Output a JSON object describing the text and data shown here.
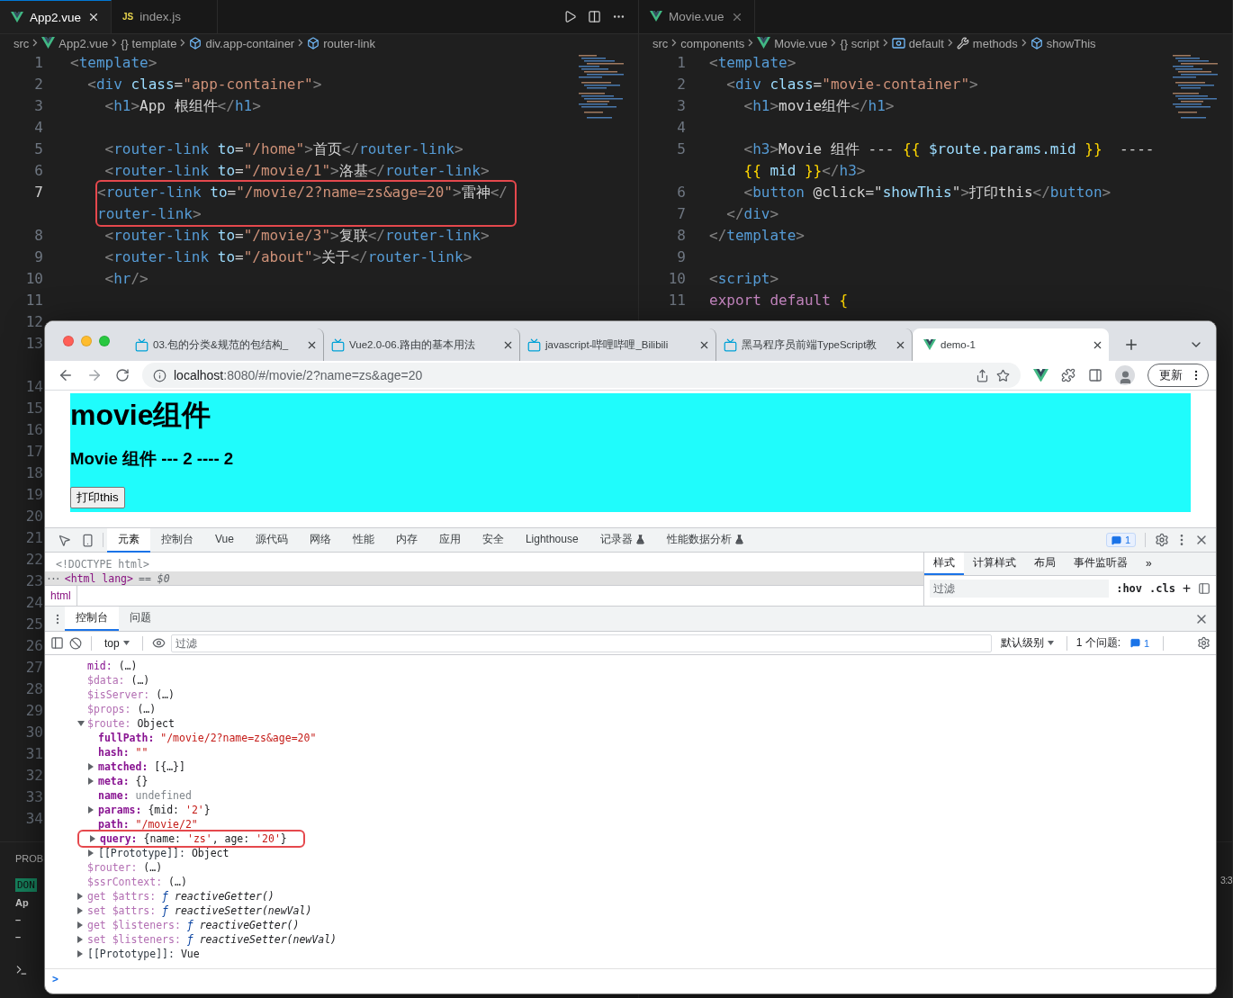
{
  "editor_left": {
    "tabs": [
      {
        "label": "App2.vue",
        "kind": "vue",
        "selected": true
      },
      {
        "label": "index.js",
        "kind": "js",
        "icon_text": "JS",
        "selected": false
      }
    ],
    "breadcrumbs": [
      {
        "kind": "plain",
        "text": "src"
      },
      {
        "kind": "vue",
        "text": "App2.vue"
      },
      {
        "kind": "plain",
        "text": "{} template"
      },
      {
        "kind": "cube",
        "text": "div.app-container"
      },
      {
        "kind": "cube",
        "text": "router-link"
      }
    ],
    "lines": [
      {
        "number": "1",
        "tokens": [
          {
            "kind": "punct",
            "text": "<"
          },
          {
            "kind": "tag",
            "text": "template"
          },
          {
            "kind": "punct",
            "text": ">"
          }
        ]
      },
      {
        "number": "2",
        "tokens": [
          {
            "kind": "punct",
            "text": "  <"
          },
          {
            "kind": "tag",
            "text": "div"
          },
          {
            "kind": "attr",
            "text": " class"
          },
          {
            "kind": "text",
            "text": "="
          },
          {
            "kind": "string",
            "text": "\"app-container\""
          },
          {
            "kind": "punct",
            "text": ">"
          }
        ]
      },
      {
        "number": "3",
        "tokens": [
          {
            "kind": "punct",
            "text": "    <"
          },
          {
            "kind": "tag",
            "text": "h1"
          },
          {
            "kind": "punct",
            "text": ">"
          },
          {
            "kind": "text",
            "text": "App 根组件"
          },
          {
            "kind": "punct",
            "text": "</"
          },
          {
            "kind": "tag",
            "text": "h1"
          },
          {
            "kind": "punct",
            "text": ">"
          }
        ]
      },
      {
        "number": "4"
      },
      {
        "number": "5",
        "tokens": [
          {
            "kind": "punct",
            "text": "    <"
          },
          {
            "kind": "tag",
            "text": "router-link"
          },
          {
            "kind": "attr",
            "text": " to"
          },
          {
            "kind": "text",
            "text": "="
          },
          {
            "kind": "string",
            "text": "\"/home\""
          },
          {
            "kind": "punct",
            "text": ">"
          },
          {
            "kind": "text",
            "text": "首页"
          },
          {
            "kind": "punct",
            "text": "</"
          },
          {
            "kind": "tag",
            "text": "router-link"
          },
          {
            "kind": "punct",
            "text": ">"
          }
        ]
      },
      {
        "number": "6",
        "tokens": [
          {
            "kind": "punct",
            "text": "    <"
          },
          {
            "kind": "tag",
            "text": "router-link"
          },
          {
            "kind": "attr",
            "text": " to"
          },
          {
            "kind": "text",
            "text": "="
          },
          {
            "kind": "string",
            "text": "\"/movie/1\""
          },
          {
            "kind": "punct",
            "text": ">"
          },
          {
            "kind": "text",
            "text": "洛基"
          },
          {
            "kind": "punct",
            "text": "</"
          },
          {
            "kind": "tag",
            "text": "router-link"
          },
          {
            "kind": "punct",
            "text": ">"
          }
        ]
      },
      {
        "number": "7",
        "highlighted": true,
        "tokens": [
          {
            "kind": "punct",
            "text": "<"
          },
          {
            "kind": "tag",
            "text": "router-link"
          },
          {
            "kind": "attr",
            "text": " to"
          },
          {
            "kind": "text",
            "text": "="
          },
          {
            "kind": "string",
            "text": "\"/movie/2?name=zs&age=20\""
          },
          {
            "kind": "punct",
            "text": ">"
          },
          {
            "kind": "text",
            "text": "雷神"
          },
          {
            "kind": "punct",
            "text": "</"
          }
        ],
        "continuation": [
          {
            "kind": "tag",
            "text": "router-link"
          },
          {
            "kind": "punct",
            "text": ">"
          }
        ]
      },
      {
        "number": "8",
        "tokens": [
          {
            "kind": "punct",
            "text": "    <"
          },
          {
            "kind": "tag",
            "text": "router-link"
          },
          {
            "kind": "attr",
            "text": " to"
          },
          {
            "kind": "text",
            "text": "="
          },
          {
            "kind": "string",
            "text": "\"/movie/3\""
          },
          {
            "kind": "punct",
            "text": ">"
          },
          {
            "kind": "text",
            "text": "复联"
          },
          {
            "kind": "punct",
            "text": "</"
          },
          {
            "kind": "tag",
            "text": "router-link"
          },
          {
            "kind": "punct",
            "text": ">"
          }
        ]
      },
      {
        "number": "9",
        "tokens": [
          {
            "kind": "punct",
            "text": "    <"
          },
          {
            "kind": "tag",
            "text": "router-link"
          },
          {
            "kind": "attr",
            "text": " to"
          },
          {
            "kind": "text",
            "text": "="
          },
          {
            "kind": "string",
            "text": "\"/about\""
          },
          {
            "kind": "punct",
            "text": ">"
          },
          {
            "kind": "text",
            "text": "关于"
          },
          {
            "kind": "punct",
            "text": "</"
          },
          {
            "kind": "tag",
            "text": "router-link"
          },
          {
            "kind": "punct",
            "text": ">"
          }
        ]
      },
      {
        "number": "10",
        "tokens": [
          {
            "kind": "punct",
            "text": "    <"
          },
          {
            "kind": "tag",
            "text": "hr"
          },
          {
            "kind": "punct",
            "text": "/>"
          }
        ]
      },
      {
        "number": "11"
      },
      {
        "number": "12"
      },
      {
        "number": "13",
        "wrapped": true
      },
      {
        "number": "14"
      },
      {
        "number": "15"
      },
      {
        "number": "16"
      },
      {
        "number": "17"
      },
      {
        "number": "18"
      },
      {
        "number": "19"
      },
      {
        "number": "20"
      },
      {
        "number": "21"
      },
      {
        "number": "22"
      },
      {
        "number": "23"
      },
      {
        "number": "24"
      },
      {
        "number": "25"
      },
      {
        "number": "26"
      },
      {
        "number": "27"
      },
      {
        "number": "28"
      },
      {
        "number": "29"
      },
      {
        "number": "30"
      },
      {
        "number": "31"
      },
      {
        "number": "32"
      },
      {
        "number": "33"
      },
      {
        "number": "34"
      }
    ],
    "panel": [
      {
        "kind": "label",
        "text": "PROB"
      },
      {
        "kind": "badge",
        "text": "DON"
      },
      {
        "kind": "text",
        "text": "Ap"
      },
      {
        "kind": "text",
        "text": "–"
      },
      {
        "kind": "text",
        "text": "–"
      }
    ]
  },
  "editor_right": {
    "tabs": [
      {
        "label": "Movie.vue",
        "kind": "vue",
        "selected": false
      }
    ],
    "breadcrumbs": [
      {
        "kind": "plain",
        "text": "src"
      },
      {
        "kind": "plain",
        "text": "components"
      },
      {
        "kind": "vue",
        "text": "Movie.vue"
      },
      {
        "kind": "plain",
        "text": "{} script"
      },
      {
        "kind": "field",
        "text": "default"
      },
      {
        "kind": "wrench",
        "text": "methods"
      },
      {
        "kind": "cube",
        "text": "showThis"
      }
    ],
    "lines": [
      {
        "number": "1",
        "tokens": [
          {
            "kind": "punct",
            "text": "<"
          },
          {
            "kind": "tag",
            "text": "template"
          },
          {
            "kind": "punct",
            "text": ">"
          }
        ]
      },
      {
        "number": "2",
        "tokens": [
          {
            "kind": "punct",
            "text": "  <"
          },
          {
            "kind": "tag",
            "text": "div"
          },
          {
            "kind": "attr",
            "text": " class"
          },
          {
            "kind": "text",
            "text": "="
          },
          {
            "kind": "string",
            "text": "\"movie-container\""
          },
          {
            "kind": "punct",
            "text": ">"
          }
        ]
      },
      {
        "number": "3",
        "tokens": [
          {
            "kind": "punct",
            "text": "    <"
          },
          {
            "kind": "tag",
            "text": "h1"
          },
          {
            "kind": "punct",
            "text": ">"
          },
          {
            "kind": "text",
            "text": "movie组件"
          },
          {
            "kind": "punct",
            "text": "</"
          },
          {
            "kind": "tag",
            "text": "h1"
          },
          {
            "kind": "punct",
            "text": ">"
          }
        ]
      },
      {
        "number": "4"
      },
      {
        "number": "5",
        "tokens": [
          {
            "kind": "punct",
            "text": "    <"
          },
          {
            "kind": "tag",
            "text": "h3"
          },
          {
            "kind": "punct",
            "text": ">"
          },
          {
            "kind": "text",
            "text": "Movie 组件 --- "
          },
          {
            "kind": "brace",
            "text": "{{"
          },
          {
            "kind": "attr",
            "text": " $route.params.mid "
          },
          {
            "kind": "brace",
            "text": "}}"
          },
          {
            "kind": "text",
            "text": "  ----"
          }
        ],
        "continuation": [
          {
            "kind": "brace",
            "text": "    {{"
          },
          {
            "kind": "attr",
            "text": " mid "
          },
          {
            "kind": "brace",
            "text": "}}"
          },
          {
            "kind": "punct",
            "text": "</"
          },
          {
            "kind": "tag",
            "text": "h3"
          },
          {
            "kind": "punct",
            "text": ">"
          }
        ]
      },
      {
        "number": "6",
        "tokens": [
          {
            "kind": "punct",
            "text": "    <"
          },
          {
            "kind": "tag",
            "text": "button"
          },
          {
            "kind": "text",
            "text": " @click=\""
          },
          {
            "kind": "attr",
            "text": "showThis"
          },
          {
            "kind": "text",
            "text": "\""
          },
          {
            "kind": "punct",
            "text": ">"
          },
          {
            "kind": "text",
            "text": "打印this"
          },
          {
            "kind": "punct",
            "text": "</"
          },
          {
            "kind": "tag",
            "text": "button"
          },
          {
            "kind": "punct",
            "text": ">"
          }
        ]
      },
      {
        "number": "7",
        "tokens": [
          {
            "kind": "punct",
            "text": "  </"
          },
          {
            "kind": "tag",
            "text": "div"
          },
          {
            "kind": "punct",
            "text": ">"
          }
        ]
      },
      {
        "number": "8",
        "tokens": [
          {
            "kind": "punct",
            "text": "</"
          },
          {
            "kind": "tag",
            "text": "template"
          },
          {
            "kind": "punct",
            "text": ">"
          }
        ]
      },
      {
        "number": "9"
      },
      {
        "number": "10",
        "tokens": [
          {
            "kind": "punct",
            "text": "<"
          },
          {
            "kind": "tag",
            "text": "script"
          },
          {
            "kind": "punct",
            "text": ">"
          }
        ]
      },
      {
        "number": "11",
        "tokens": [
          {
            "kind": "keyword",
            "text": "export default "
          },
          {
            "kind": "brace",
            "text": "{"
          }
        ]
      }
    ],
    "panel": [
      {
        "kind": "status",
        "text": "3:3"
      }
    ]
  },
  "browser": {
    "tabs": [
      {
        "title": "03.包的分类&规范的包结构_",
        "kind": "tv",
        "selected": false
      },
      {
        "title": "Vue2.0-06.路由的基本用法",
        "kind": "tv",
        "selected": false
      },
      {
        "title": "javascript-哔哩哔哩_Bilibili",
        "kind": "tv",
        "selected": false
      },
      {
        "title": "黑马程序员前端TypeScript教",
        "kind": "tv",
        "selected": false
      },
      {
        "title": "demo-1",
        "kind": "vue",
        "selected": true
      }
    ],
    "url": {
      "host": "localhost",
      "path": ":8080/#/movie/2?name=zs&age=20"
    },
    "update_button": "更新",
    "page": {
      "heading": "movie组件",
      "subheading": "Movie 组件 --- 2 ---- 2",
      "button": "打印this"
    },
    "devtools": {
      "tabs": [
        {
          "label": "元素",
          "selected": true
        },
        {
          "label": "控制台",
          "selected": false
        },
        {
          "label": "Vue",
          "selected": false
        },
        {
          "label": "源代码",
          "selected": false
        },
        {
          "label": "网络",
          "selected": false
        },
        {
          "label": "性能",
          "selected": false
        },
        {
          "label": "内存",
          "selected": false
        },
        {
          "label": "应用",
          "selected": false
        },
        {
          "label": "安全",
          "selected": false
        },
        {
          "label": "Lighthouse",
          "selected": false
        },
        {
          "label": "记录器",
          "selected": false,
          "experimental": true
        },
        {
          "label": "性能数据分析",
          "selected": false,
          "experimental": true
        }
      ],
      "issues_badge": "1",
      "elements": {
        "rows": [
          {
            "kind": "doctype",
            "text": "<!DOCTYPE html>",
            "selected": false
          },
          {
            "kind": "element",
            "prefix": "···",
            "text": "<html lang>",
            "suffix": "== $0",
            "selected": true
          }
        ],
        "breadcrumb": "html"
      },
      "styles": {
        "tabs": [
          {
            "label": "样式",
            "selected": true
          },
          {
            "label": "计算样式",
            "selected": false
          },
          {
            "label": "布局",
            "selected": false
          },
          {
            "label": "事件监听器",
            "selected": false
          }
        ],
        "more": "»",
        "filter_placeholder": "过滤",
        "hov": ":hov",
        "cls": ".cls",
        "add": "+"
      },
      "drawer": {
        "tabs": [
          {
            "label": "控制台",
            "selected": true
          },
          {
            "label": "问题",
            "selected": false
          }
        ]
      },
      "console": {
        "context": "top",
        "filter_placeholder": "过滤",
        "level": "默认级别",
        "issues_label": "1 个问题:",
        "issues_count": "1",
        "entries": [
          {
            "key": "mid:",
            "kind": "own",
            "parts": [
              {
                "kind": "plain",
                "text": "(…)"
              }
            ]
          },
          {
            "key": "$data:",
            "kind": "inherited",
            "parts": [
              {
                "kind": "plain",
                "text": "(…)"
              }
            ]
          },
          {
            "key": "$isServer:",
            "kind": "inherited",
            "parts": [
              {
                "kind": "plain",
                "text": "(…)"
              }
            ]
          },
          {
            "key": "$props:",
            "kind": "inherited",
            "parts": [
              {
                "kind": "plain",
                "text": "(…)"
              }
            ]
          },
          {
            "expanded": true,
            "key": "$route:",
            "kind": "inherited",
            "parts": [
              {
                "kind": "plain",
                "text": "Object"
              }
            ],
            "children": [
              {
                "key": "fullPath:",
                "kind": "bold",
                "parts": [
                  {
                    "kind": "string",
                    "text": "\"/movie/2?name=zs&age=20\""
                  }
                ]
              },
              {
                "key": "hash:",
                "kind": "bold",
                "parts": [
                  {
                    "kind": "string",
                    "text": "\"\""
                  }
                ]
              },
              {
                "expanded": false,
                "key": "matched:",
                "kind": "bold",
                "parts": [
                  {
                    "kind": "plain",
                    "text": "[{…}]"
                  }
                ]
              },
              {
                "expanded": false,
                "key": "meta:",
                "kind": "bold",
                "parts": [
                  {
                    "kind": "plain",
                    "text": "{}"
                  }
                ]
              },
              {
                "key": "name:",
                "kind": "bold",
                "parts": [
                  {
                    "kind": "muted",
                    "text": "undefined"
                  }
                ]
              },
              {
                "expanded": false,
                "key": "params:",
                "kind": "bold",
                "parts": [
                  {
                    "kind": "plain",
                    "text": "{mid: "
                  },
                  {
                    "kind": "string",
                    "text": "'2'"
                  },
                  {
                    "kind": "plain",
                    "text": "}"
                  }
                ]
              },
              {
                "key": "path:",
                "kind": "bold",
                "parts": [
                  {
                    "kind": "string",
                    "text": "\"/movie/2\""
                  }
                ]
              },
              {
                "expanded": false,
                "key": "query:",
                "kind": "bold",
                "highlighted": true,
                "parts": [
                  {
                    "kind": "plain",
                    "text": "{name: "
                  },
                  {
                    "kind": "string",
                    "text": "'zs'"
                  },
                  {
                    "kind": "plain",
                    "text": ", age: "
                  },
                  {
                    "kind": "string",
                    "text": "'20'"
                  },
                  {
                    "kind": "plain",
                    "text": "}"
                  }
                ]
              },
              {
                "expanded": false,
                "key": "[[Prototype]]:",
                "kind": "internal",
                "parts": [
                  {
                    "kind": "plain",
                    "text": "Object"
                  }
                ]
              }
            ]
          },
          {
            "key": "$router:",
            "kind": "inherited",
            "parts": [
              {
                "kind": "plain",
                "text": "(…)"
              }
            ]
          },
          {
            "key": "$ssrContext:",
            "kind": "inherited",
            "parts": [
              {
                "kind": "plain",
                "text": "(…)"
              }
            ]
          },
          {
            "expanded": false,
            "key": "get $attrs:",
            "kind": "inherited",
            "parts": [
              {
                "kind": "func",
                "text": "ƒ"
              },
              {
                "kind": "italic",
                "text": "reactiveGetter()"
              }
            ]
          },
          {
            "expanded": false,
            "key": "set $attrs:",
            "kind": "inherited",
            "parts": [
              {
                "kind": "func",
                "text": "ƒ"
              },
              {
                "kind": "italic",
                "text": "reactiveSetter(newVal)"
              }
            ]
          },
          {
            "expanded": false,
            "key": "get $listeners:",
            "kind": "inherited",
            "parts": [
              {
                "kind": "func",
                "text": "ƒ"
              },
              {
                "kind": "italic",
                "text": "reactiveGetter()"
              }
            ]
          },
          {
            "expanded": false,
            "key": "set $listeners:",
            "kind": "inherited",
            "parts": [
              {
                "kind": "func",
                "text": "ƒ"
              },
              {
                "kind": "italic",
                "text": "reactiveSetter(newVal)"
              }
            ]
          },
          {
            "expanded": false,
            "key": "[[Prototype]]:",
            "kind": "internal",
            "parts": [
              {
                "kind": "plain",
                "text": "Vue"
              }
            ]
          }
        ],
        "prompt": ">"
      }
    }
  }
}
